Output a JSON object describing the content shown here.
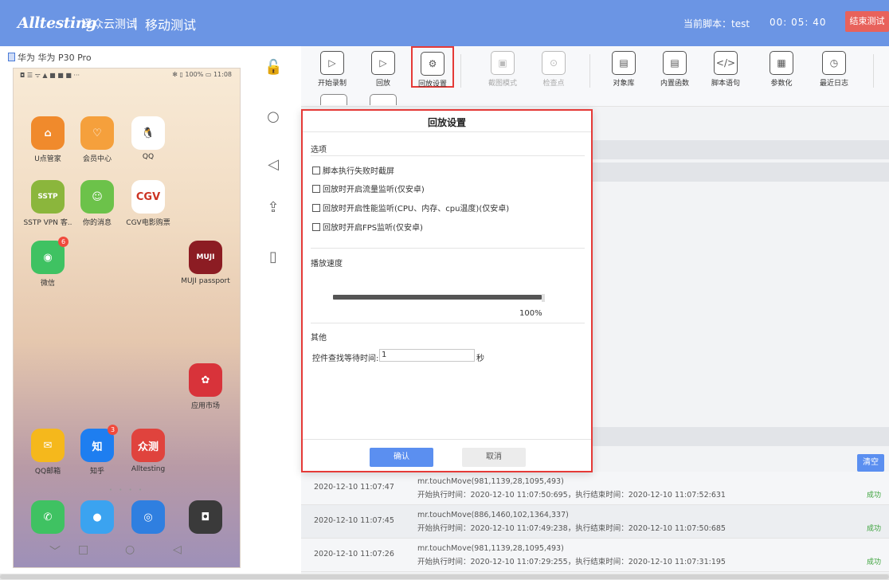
{
  "header": {
    "logo_text": "Alltesting",
    "logo_cn": "泽众云测试",
    "separator": "|",
    "title": "移动测试",
    "script_label": "当前脚本：test",
    "timer": "00:  05:  40",
    "stop_button": "结束测试",
    "colors": {
      "bar": "#6b95e4",
      "stop": "#e8625b"
    }
  },
  "device": {
    "name": "华为 华为 P30 Pro",
    "status_left": "◘ ☰ ᯤ ▲ ■ ■ ■ ···",
    "status_right": "✻ ▯ 100% ▭ 11:08",
    "apps": [
      {
        "label": "U点管家",
        "icon": "u-home-icon",
        "color": "#f08a2c",
        "glyph": "⌂"
      },
      {
        "label": "会员中心",
        "icon": "member-heart-icon",
        "color": "#f5a03c",
        "glyph": "♡"
      },
      {
        "label": "QQ",
        "icon": "qq-penguin-icon",
        "color": "#ffffff",
        "glyph": "🐧"
      },
      {
        "label": "SSTP VPN 客..",
        "icon": "sstp-vpn-icon",
        "color": "#8bb63c",
        "glyph": "SSTP"
      },
      {
        "label": "你的消息",
        "icon": "message-face-icon",
        "color": "#6cc24a",
        "glyph": "☺"
      },
      {
        "label": "CGV电影购票",
        "icon": "cgv-icon",
        "color": "#ffffff",
        "glyph": "CGV"
      },
      {
        "label": "微信",
        "icon": "wechat-icon",
        "color": "#3fc262",
        "glyph": "◉",
        "badge": "6"
      },
      {
        "label": "MUJI passport",
        "icon": "muji-icon",
        "color": "#8c1c23",
        "glyph": "MUJI"
      },
      {
        "label": "应用市场",
        "icon": "huawei-appgallery-icon",
        "color": "#d8333a",
        "glyph": "✿"
      },
      {
        "label": "QQ邮箱",
        "icon": "qq-mail-icon",
        "color": "#f5b81c",
        "glyph": "✉"
      },
      {
        "label": "知乎",
        "icon": "zhihu-icon",
        "color": "#1e7ef0",
        "glyph": "知",
        "badge": "3"
      },
      {
        "label": "Alltesting",
        "icon": "alltesting-app-icon",
        "color": "#e0433d",
        "glyph": "众测"
      },
      {
        "label": "",
        "icon": "phone-call-icon",
        "color": "#3fc262",
        "glyph": "✆"
      },
      {
        "label": "",
        "icon": "messages-bubble-icon",
        "color": "#3ba3f0",
        "glyph": "●"
      },
      {
        "label": "",
        "icon": "browser-globe-icon",
        "color": "#2f7fe0",
        "glyph": "◎"
      },
      {
        "label": "",
        "icon": "camera-icon",
        "color": "#3a3a3a",
        "glyph": "◘"
      }
    ],
    "page_dots": "• • • •",
    "nav": [
      "﹀",
      "□",
      "○",
      "◁"
    ]
  },
  "side_tools": [
    {
      "name": "unlock-icon",
      "glyph": "🔓"
    },
    {
      "name": "home-circle-icon",
      "glyph": "○"
    },
    {
      "name": "back-triangle-icon",
      "glyph": "◁"
    },
    {
      "name": "cloud-upload-icon",
      "glyph": "⇪"
    },
    {
      "name": "rotate-phone-icon",
      "glyph": "▯"
    }
  ],
  "toolbar": {
    "items": [
      {
        "label": "开始录制",
        "icon": "record-play-icon",
        "glyph": "▷",
        "state": "normal"
      },
      {
        "label": "回放",
        "icon": "replay-icon",
        "glyph": "▷",
        "state": "normal"
      },
      {
        "label": "回放设置",
        "icon": "replay-settings-gear-icon",
        "glyph": "⚙",
        "state": "active"
      },
      {
        "label": "截图模式",
        "icon": "screenshot-mode-icon",
        "glyph": "▣",
        "state": "disabled"
      },
      {
        "label": "检查点",
        "icon": "checkpoint-icon",
        "glyph": "⊙",
        "state": "disabled"
      },
      {
        "label": "对象库",
        "icon": "object-library-icon",
        "glyph": "▤",
        "state": "normal"
      },
      {
        "label": "内置函数",
        "icon": "builtin-function-icon",
        "glyph": "▤",
        "state": "normal"
      },
      {
        "label": "脚本语句",
        "icon": "script-code-icon",
        "glyph": "</>",
        "state": "normal"
      },
      {
        "label": "参数化",
        "icon": "parameterize-icon",
        "glyph": "▦",
        "state": "normal"
      },
      {
        "label": "最近日志",
        "icon": "recent-log-icon",
        "glyph": "◷",
        "state": "normal"
      }
    ]
  },
  "modal": {
    "title": "回放设置",
    "section_options": "选项",
    "options": [
      "脚本执行失败时截屏",
      "回放时开启流量监听(仅安卓)",
      "回放时开启性能监听(CPU、内存、cpu温度)(仅安卓)",
      "回放时开启FPS监听(仅安卓)"
    ],
    "section_speed": "播放速度",
    "speed_value": "100%",
    "speed_fraction": 1.0,
    "section_other": "其他",
    "wait_label": "控件查找等待时间:",
    "wait_value": "1",
    "wait_unit": "秒",
    "confirm": "确认",
    "cancel": "取消"
  },
  "log": {
    "clear_button": "清空",
    "rows": [
      {
        "time": "2020-12-10 11:07:47",
        "cmd": "mr.touchMove(981,1139,28,1095,493)",
        "info": "开始执行时间：2020-12-10 11:07:50:695，执行结束时间：2020-12-10 11:07:52:631",
        "status": "成功"
      },
      {
        "time": "2020-12-10 11:07:45",
        "cmd": "mr.touchMove(886,1460,102,1364,337)",
        "info": "开始执行时间：2020-12-10 11:07:49:238，执行结束时间：2020-12-10 11:07:50:685",
        "status": "成功"
      },
      {
        "time": "2020-12-10 11:07:26",
        "cmd": "mr.touchMove(981,1139,28,1095,493)",
        "info": "开始执行时间：2020-12-10 11:07:29:255，执行结束时间：2020-12-10 11:07:31:195",
        "status": "成功"
      }
    ]
  }
}
